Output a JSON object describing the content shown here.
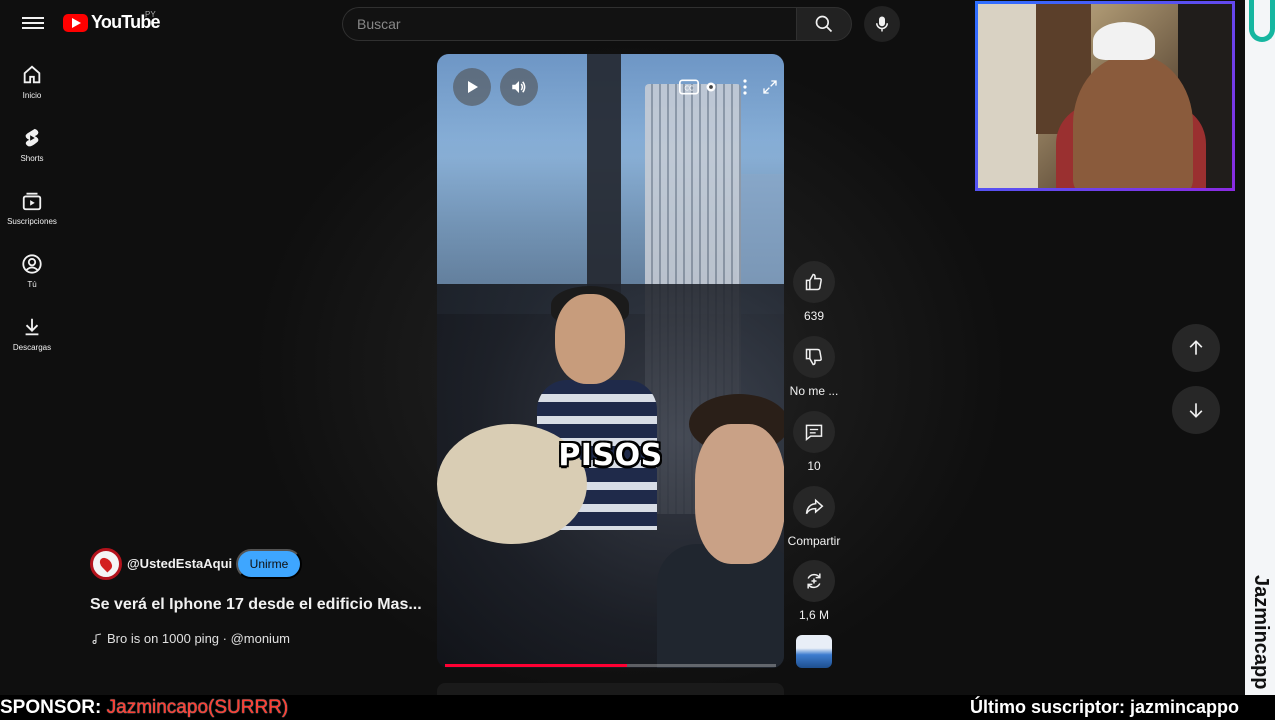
{
  "header": {
    "logo_text": "YouTube",
    "country_code": "PY",
    "search_placeholder": "Buscar"
  },
  "sidebar": {
    "items": [
      {
        "label": "Inicio",
        "icon": "home-icon"
      },
      {
        "label": "Shorts",
        "icon": "shorts-icon"
      },
      {
        "label": "Suscripciones",
        "icon": "subscriptions-icon"
      },
      {
        "label": "Tú",
        "icon": "account-icon"
      },
      {
        "label": "Descargas",
        "icon": "download-icon"
      }
    ]
  },
  "video": {
    "caption": "PISOS",
    "progress_fraction": 0.55
  },
  "actions": {
    "like_count": "639",
    "dislike_label": "No me ...",
    "comment_count": "10",
    "share_label": "Compartir",
    "remix_count": "1,6 M"
  },
  "channel": {
    "handle": "@UstedEstaAqui",
    "join_label": "Unirme",
    "title": "Se verá el Iphone 17 desde el edificio Mas...",
    "sound": "Bro is on 1000 ping · @monium"
  },
  "overlay": {
    "sponsor_prefix": "SPONSOR: ",
    "sponsor_name": "Jazmincapo(SURRR)",
    "last_subscriber": "Último suscriptor: jazmincappo",
    "vertical_name": "Jazmincapp"
  },
  "colors": {
    "accent_blue": "#3ea6ff",
    "youtube_red": "#ff0000",
    "progress_red": "#ff0033",
    "sponsor_red": "#ff3b30"
  }
}
